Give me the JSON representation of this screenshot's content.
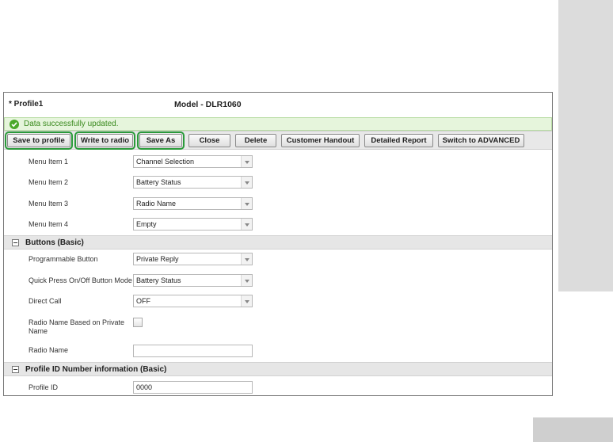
{
  "profile": {
    "name": "* Profile1",
    "model": "Model - DLR1060"
  },
  "status": {
    "message": "Data successfully updated."
  },
  "toolbar": {
    "buttons": [
      {
        "label": "Save to profile"
      },
      {
        "label": "Write to radio"
      },
      {
        "label": "Save As"
      },
      {
        "label": "Close"
      },
      {
        "label": "Delete"
      },
      {
        "label": "Customer Handout"
      },
      {
        "label": "Detailed Report"
      },
      {
        "label": "Switch to ADVANCED"
      }
    ],
    "highlight_color": "#2a9a3a"
  },
  "menu_items": [
    {
      "label": "Menu Item 1",
      "value": "Channel Selection"
    },
    {
      "label": "Menu Item 2",
      "value": "Battery Status"
    },
    {
      "label": "Menu Item 3",
      "value": "Radio Name"
    },
    {
      "label": "Menu Item 4",
      "value": "Empty"
    }
  ],
  "buttons_section": {
    "title": "Buttons (Basic)",
    "programmable_button": {
      "label": "Programmable Button",
      "value": "Private Reply"
    },
    "quick_press": {
      "label": "Quick Press On/Off Button Mode",
      "value": "Battery Status"
    },
    "direct_call": {
      "label": "Direct Call",
      "value": "OFF"
    },
    "radio_name_private": {
      "label": "Radio Name Based on Private Name",
      "checked": false
    },
    "radio_name": {
      "label": "Radio Name",
      "value": ""
    }
  },
  "profile_id_section": {
    "title": "Profile ID Number information (Basic)",
    "profile_id": {
      "label": "Profile ID",
      "value": "0000"
    }
  },
  "icons": {
    "status": "check-circle-icon",
    "section_toggle": "collapse-minus-icon",
    "dropdown": "dropdown-arrow-icon"
  }
}
